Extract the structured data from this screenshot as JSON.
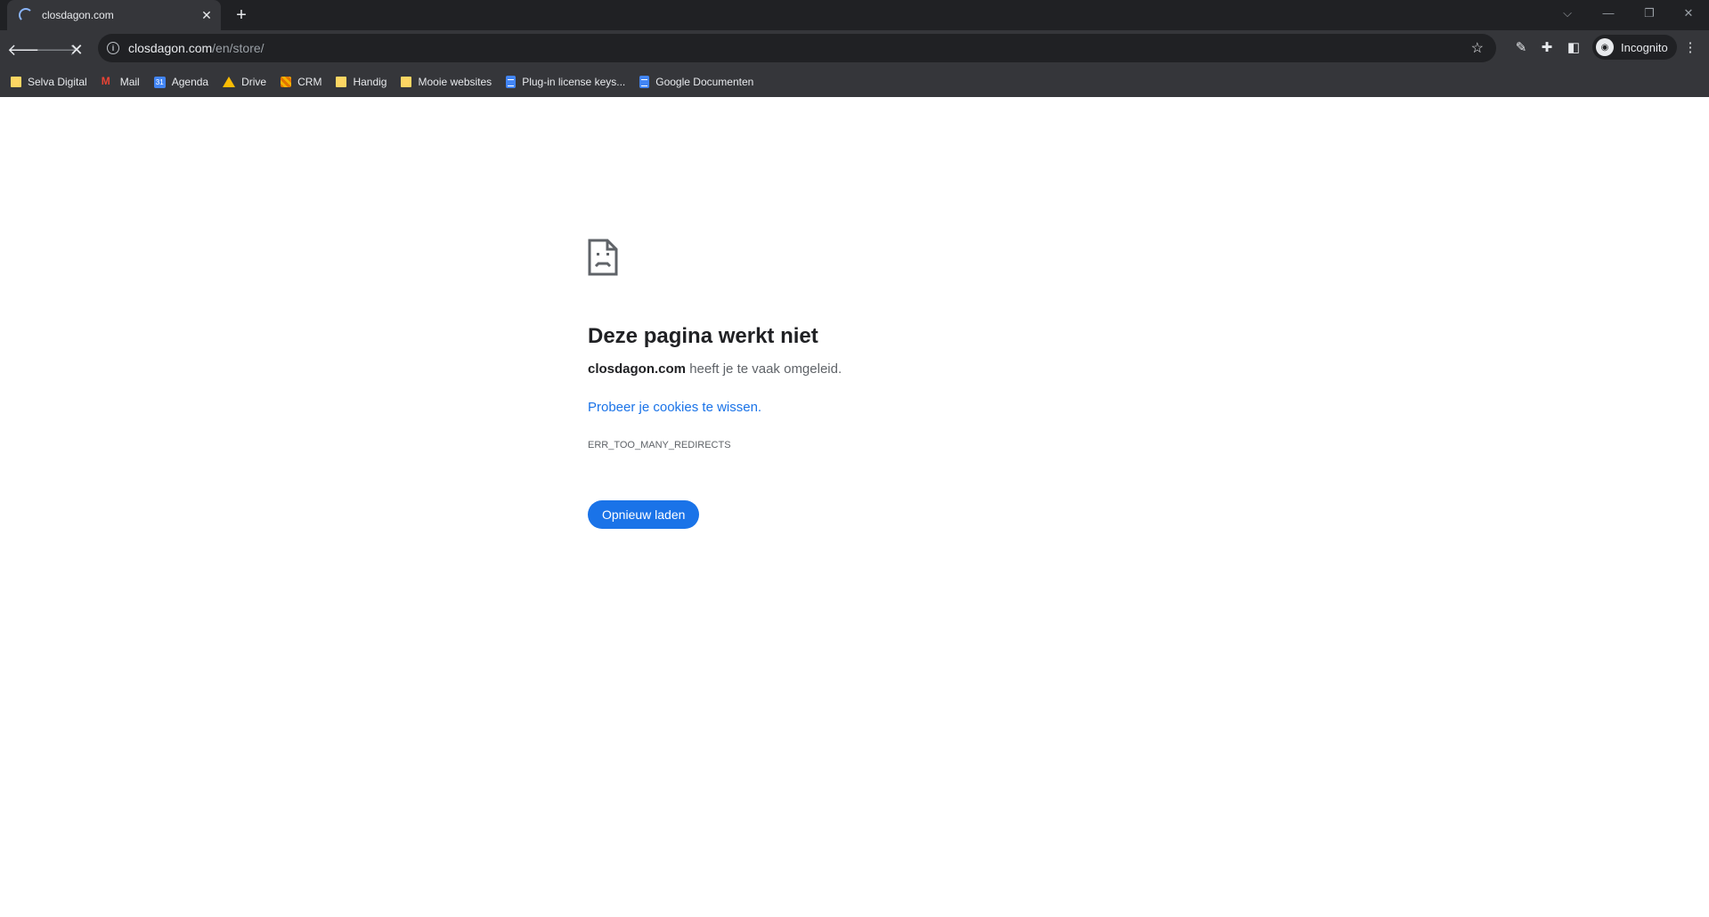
{
  "tab": {
    "title": "closdagon.com"
  },
  "window_controls": {
    "dropdown": "⌵",
    "minimize": "—",
    "restore": "❐",
    "close": "✕"
  },
  "omnibox": {
    "host": "closdagon.com",
    "path": "/en/store/"
  },
  "profile": {
    "label": "Incognito"
  },
  "bookmarks": [
    {
      "label": "Selva Digital",
      "icon": "folder-icon"
    },
    {
      "label": "Mail",
      "icon": "gmail-icon"
    },
    {
      "label": "Agenda",
      "icon": "calendar-icon"
    },
    {
      "label": "Drive",
      "icon": "drive-icon"
    },
    {
      "label": "CRM",
      "icon": "crm-icon"
    },
    {
      "label": "Handig",
      "icon": "folder-icon"
    },
    {
      "label": "Mooie websites",
      "icon": "folder-icon"
    },
    {
      "label": "Plug-in license keys...",
      "icon": "doc-icon"
    },
    {
      "label": "Google Documenten",
      "icon": "doc-icon"
    }
  ],
  "error": {
    "heading": "Deze pagina werkt niet",
    "site": "closdagon.com",
    "message_rest": " heeft je te vaak omgeleid.",
    "suggestion_link": "Probeer je cookies te wissen.",
    "code": "ERR_TOO_MANY_REDIRECTS",
    "reload_button": "Opnieuw laden"
  },
  "colors": {
    "accent": "#1a73e8",
    "frame": "#202124",
    "toolbar": "#35363a"
  }
}
